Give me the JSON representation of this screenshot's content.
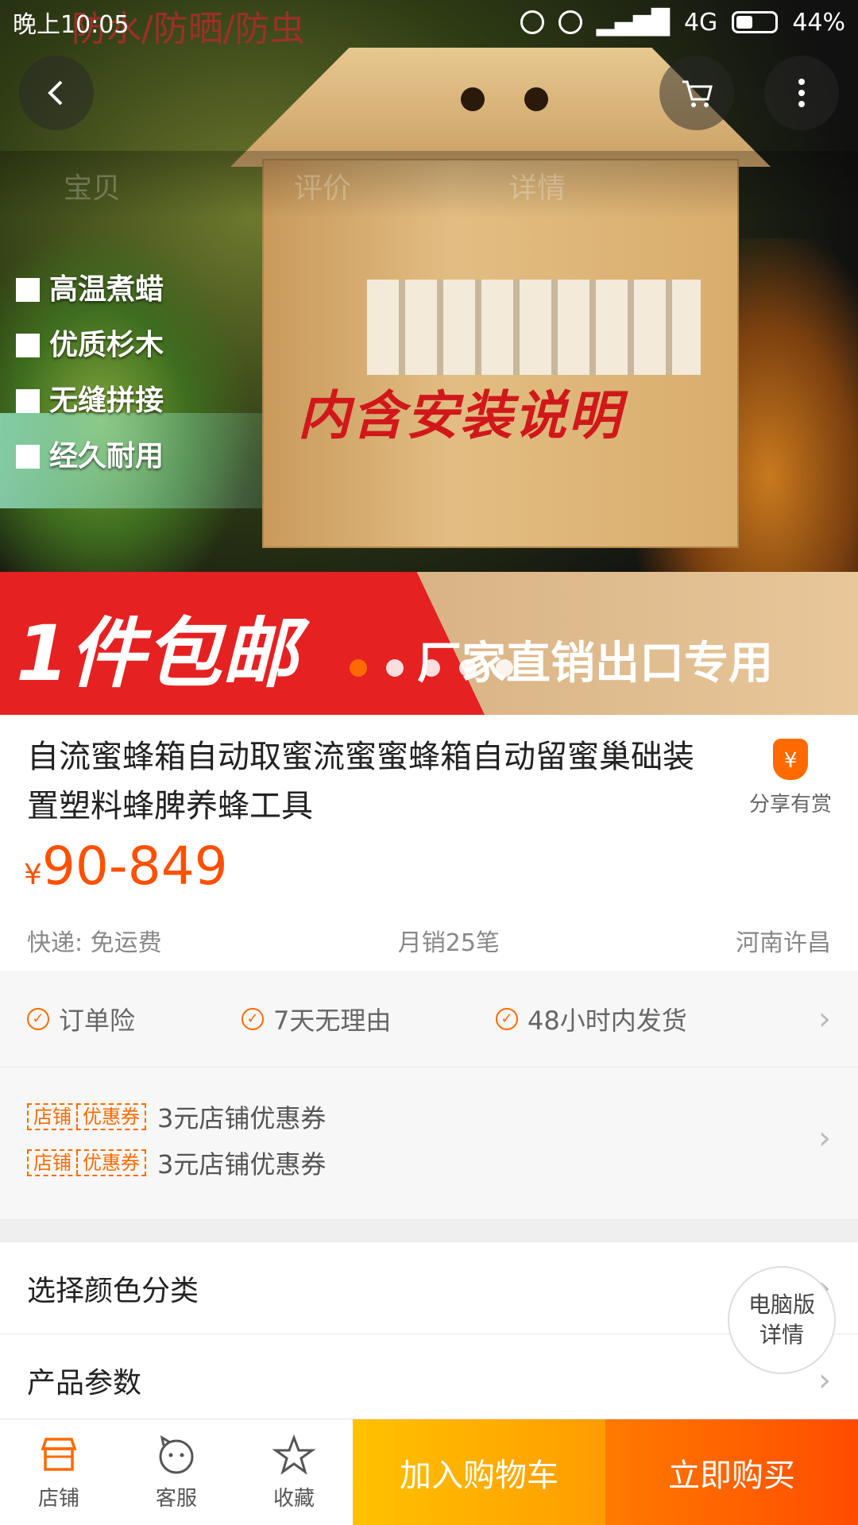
{
  "status_bar": {
    "time": "晚上10:05",
    "network": "4G",
    "battery": "44%"
  },
  "hero": {
    "overlay_title": "防水/防晒/防虫",
    "ghost_tabs": [
      "宝贝",
      "评价",
      "详情"
    ],
    "bullets": [
      "高温煮蜡",
      "优质杉木",
      "无缝拼接",
      "经久耐用"
    ],
    "banner_text": "内含安装说明",
    "ribbon_big": "1件包邮",
    "ribbon_small": "厂家直销出口专用",
    "dots": {
      "count": 5,
      "active_index": 0
    }
  },
  "nav": {
    "back_icon": "chevron-left-icon",
    "cart_icon": "cart-icon",
    "more_icon": "more-vertical-icon"
  },
  "product": {
    "title": "自流蜜蜂箱自动取蜜流蜜蜜蜂箱自动留蜜巢础装置塑料蜂脾养蜂工具",
    "price_symbol": "¥",
    "price": "90-849",
    "share_label": "分享有赏",
    "share_icon_text": "¥",
    "shipping": "快递: 免运费",
    "monthly_sales": "月销25笔",
    "location": "河南许昌"
  },
  "guarantees": [
    "订单险",
    "7天无理由",
    "48小时内发货"
  ],
  "coupons": [
    {
      "tag_left": "店铺",
      "tag_right": "优惠券",
      "text": "3元店铺优惠券"
    },
    {
      "tag_left": "店铺",
      "tag_right": "优惠券",
      "text": "3元店铺优惠券"
    }
  ],
  "rows": {
    "color_select": "选择颜色分类",
    "params": "产品参数"
  },
  "pc_button": {
    "line1": "电脑版",
    "line2": "详情"
  },
  "bottom_bar": {
    "shop": "店铺",
    "service": "客服",
    "favorite": "收藏",
    "add_cart": "加入购物车",
    "buy_now": "立即购买"
  },
  "colors": {
    "accent": "#ff5000",
    "cart_button": "#ffb000",
    "buy_button": "#ff5a00"
  }
}
